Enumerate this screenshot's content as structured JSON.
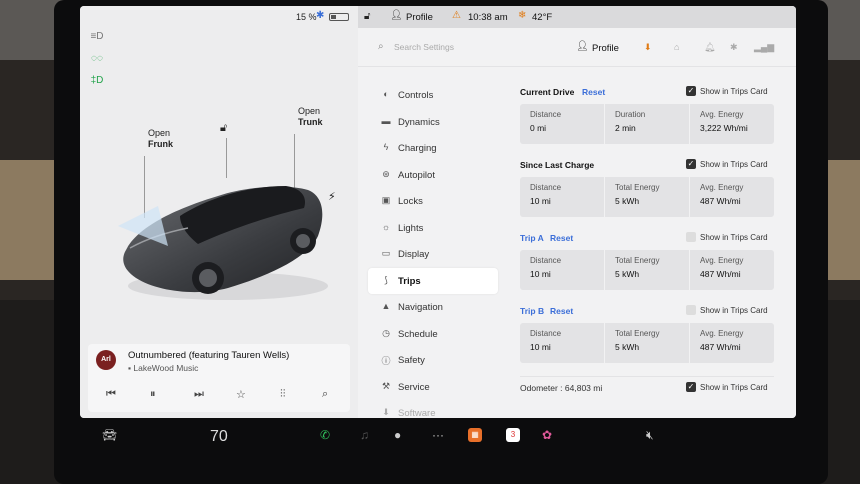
{
  "status": {
    "battery_pct": "15 %",
    "profile": "Profile",
    "time": "10:38 am",
    "temperature": "42°F"
  },
  "left_panel": {
    "callouts": {
      "frunk": {
        "line1": "Open",
        "line2": "Frunk"
      },
      "trunk": {
        "line1": "Open",
        "line2": "Trunk"
      }
    },
    "side_icons": [
      "headlights-icon",
      "parking-lights-icon",
      "fog-lights-icon"
    ]
  },
  "media": {
    "album_badge": "Arl",
    "title": "Outnumbered (featuring Tauren Wells)",
    "artist": "LakeWood Music",
    "controls": [
      "previous-icon",
      "pause-icon",
      "next-icon",
      "favorite-icon",
      "equalizer-icon",
      "search-icon"
    ]
  },
  "settings": {
    "search_placeholder": "Search Settings",
    "profile_label": "Profile",
    "nav": [
      {
        "label": "Controls",
        "icon": "toggle-icon"
      },
      {
        "label": "Dynamics",
        "icon": "car-icon"
      },
      {
        "label": "Charging",
        "icon": "bolt-icon"
      },
      {
        "label": "Autopilot",
        "icon": "steering-wheel-icon"
      },
      {
        "label": "Locks",
        "icon": "lock-icon"
      },
      {
        "label": "Lights",
        "icon": "sun-icon"
      },
      {
        "label": "Display",
        "icon": "display-icon"
      },
      {
        "label": "Trips",
        "icon": "trips-icon",
        "active": true
      },
      {
        "label": "Navigation",
        "icon": "navigation-icon"
      },
      {
        "label": "Schedule",
        "icon": "clock-icon"
      },
      {
        "label": "Safety",
        "icon": "info-icon"
      },
      {
        "label": "Service",
        "icon": "wrench-icon"
      },
      {
        "label": "Software",
        "icon": "download-icon"
      }
    ]
  },
  "trips": {
    "show_in_card_label": "Show in Trips Card",
    "reset_label": "Reset",
    "sections": [
      {
        "title": "Current Drive",
        "has_reset": true,
        "checked": true,
        "blue": false,
        "stats": [
          {
            "label": "Distance",
            "value": "0 mi"
          },
          {
            "label": "Duration",
            "value": "2 min"
          },
          {
            "label": "Avg. Energy",
            "value": "3,222 Wh/mi"
          }
        ]
      },
      {
        "title": "Since Last Charge",
        "has_reset": false,
        "checked": true,
        "blue": false,
        "stats": [
          {
            "label": "Distance",
            "value": "10 mi"
          },
          {
            "label": "Total Energy",
            "value": "5 kWh"
          },
          {
            "label": "Avg. Energy",
            "value": "487 Wh/mi"
          }
        ]
      },
      {
        "title": "Trip A",
        "has_reset": true,
        "checked": false,
        "blue": true,
        "stats": [
          {
            "label": "Distance",
            "value": "10 mi"
          },
          {
            "label": "Total Energy",
            "value": "5 kWh"
          },
          {
            "label": "Avg. Energy",
            "value": "487 Wh/mi"
          }
        ]
      },
      {
        "title": "Trip B",
        "has_reset": true,
        "checked": false,
        "blue": true,
        "stats": [
          {
            "label": "Distance",
            "value": "10 mi"
          },
          {
            "label": "Total Energy",
            "value": "5 kWh"
          },
          {
            "label": "Avg. Energy",
            "value": "487 Wh/mi"
          }
        ]
      }
    ],
    "odometer_label": "Odometer :",
    "odometer_value": "64,803 mi",
    "odometer_checked": true
  },
  "taskbar": {
    "temperature_setpoint": "70",
    "calendar_day": "3"
  },
  "colors": {
    "accent_blue": "#3b6ed8",
    "warning_orange": "#e07b15",
    "green": "#22a34a"
  }
}
